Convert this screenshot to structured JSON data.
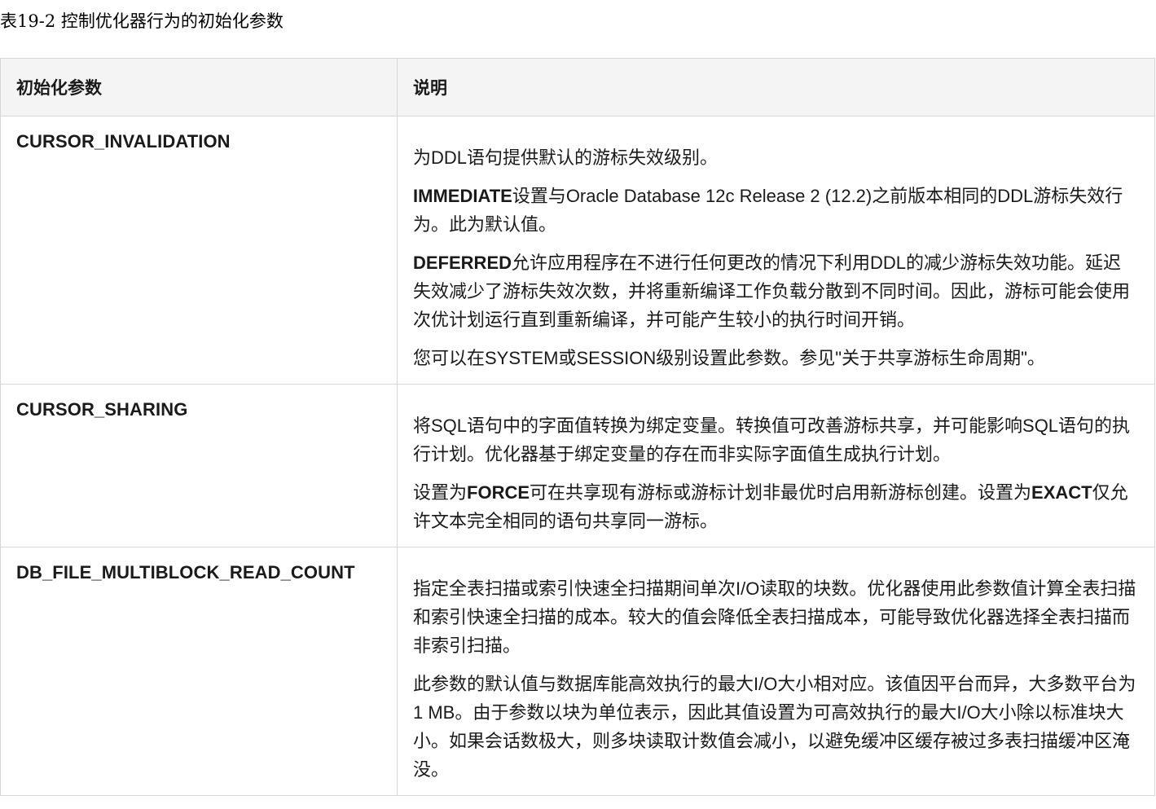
{
  "caption": "表19-2 控制优化器行为的初始化参数",
  "table": {
    "headers": [
      "初始化参数",
      "说明"
    ],
    "rows": [
      {
        "name": "CURSOR_INVALIDATION",
        "paragraphs": [
          {
            "text": "为DDL语句提供默认的游标失效级别。"
          },
          {
            "keyword": "IMMEDIATE",
            "text": "设置与Oracle Database 12c Release 2 (12.2)之前版本相同的DDL游标失效行为。此为默认值。"
          },
          {
            "keyword": "DEFERRED",
            "text": "允许应用程序在不进行任何更改的情况下利用DDL的减少游标失效功能。延迟失效减少了游标失效次数，并将重新编译工作负载分散到不同时间。因此，游标可能会使用次优计划运行直到重新编译，并可能产生较小的执行时间开销。"
          },
          {
            "text": "您可以在SYSTEM或SESSION级别设置此参数。参见\"关于共享游标生命周期\"。"
          }
        ]
      },
      {
        "name": "CURSOR_SHARING",
        "paragraphs": [
          {
            "text": "将SQL语句中的字面值转换为绑定变量。转换值可改善游标共享，并可能影响SQL语句的执行计划。优化器基于绑定变量的存在而非实际字面值生成执行计划。"
          },
          {
            "pre": "设置为",
            "keyword": "FORCE",
            "text": "可在共享现有游标或游标计划非最优时启用新游标创建。设置为",
            "keyword2": "EXACT",
            "text2": "仅允许文本完全相同的语句共享同一游标。"
          }
        ]
      },
      {
        "name": "DB_FILE_MULTIBLOCK_READ_COUNT",
        "paragraphs": [
          {
            "text": "指定全表扫描或索引快速全扫描期间单次I/O读取的块数。优化器使用此参数值计算全表扫描和索引快速全扫描的成本。较大的值会降低全表扫描成本，可能导致优化器选择全表扫描而非索引扫描。"
          },
          {
            "text": "此参数的默认值与数据库能高效执行的最大I/O大小相对应。该值因平台而异，大多数平台为1 MB。由于参数以块为单位表示，因此其值设置为可高效执行的最大I/O大小除以标准块大小。如果会话数极大，则多块读取计数值会减小，以避免缓冲区缓存被过多表扫描缓冲区淹没。"
          }
        ]
      }
    ]
  }
}
